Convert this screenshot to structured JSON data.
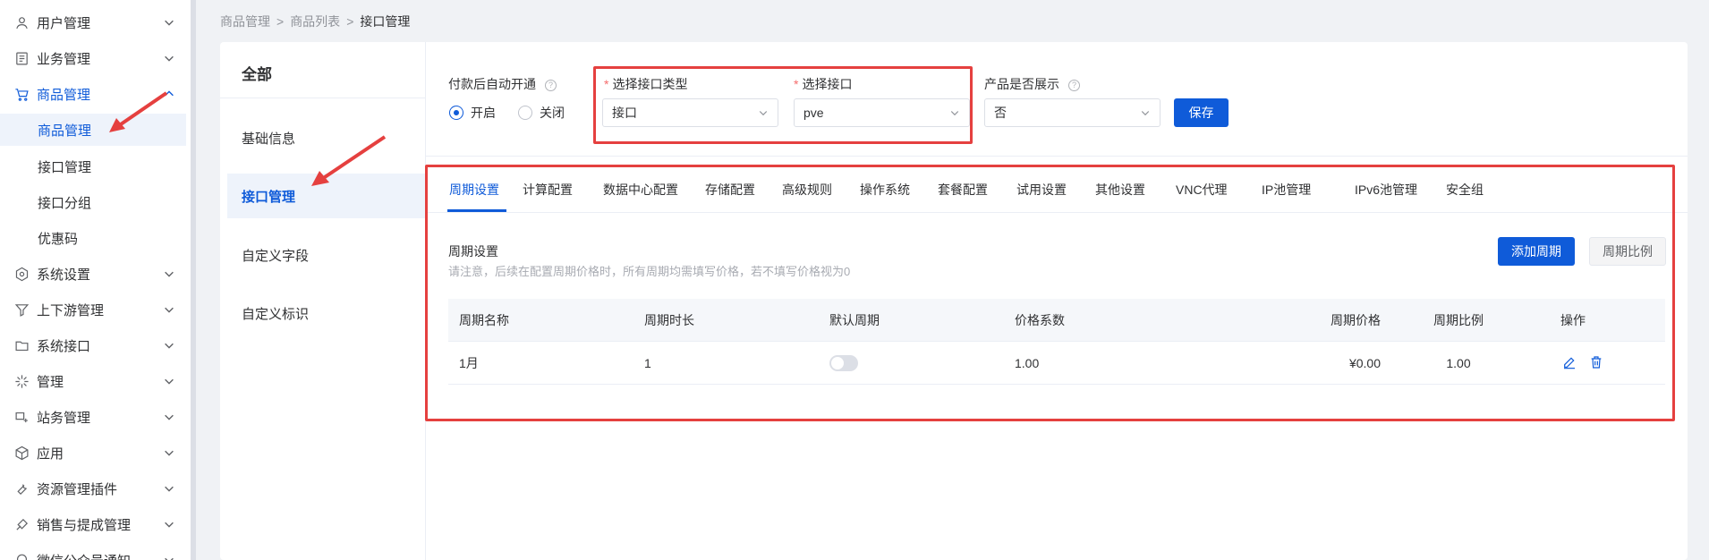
{
  "sidebar": {
    "items": [
      {
        "label": "用户管理",
        "icon": "user-icon"
      },
      {
        "label": "业务管理",
        "icon": "document-icon"
      },
      {
        "label": "商品管理",
        "icon": "cart-icon"
      },
      {
        "label": "系统设置",
        "icon": "gear-icon"
      },
      {
        "label": "上下游管理",
        "icon": "filter-icon"
      },
      {
        "label": "系统接口",
        "icon": "folder-icon"
      },
      {
        "label": "管理",
        "icon": "sparkle-icon"
      },
      {
        "label": "站务管理",
        "icon": "station-icon"
      },
      {
        "label": "应用",
        "icon": "cube-icon"
      },
      {
        "label": "资源管理插件",
        "icon": "wrench-icon"
      },
      {
        "label": "销售与提成管理",
        "icon": "sales-icon"
      },
      {
        "label": "微信公众号通知",
        "icon": "wechat-icon"
      }
    ],
    "product_sub": [
      "商品管理",
      "接口管理",
      "接口分组",
      "优惠码"
    ]
  },
  "breadcrumb": [
    "商品管理",
    "商品列表",
    "接口管理"
  ],
  "breadcrumb_sep": ">",
  "leftnav": {
    "title": "全部",
    "items": [
      "基础信息",
      "接口管理",
      "自定义字段",
      "自定义标识"
    ]
  },
  "form": {
    "auto_open_label": "付款后自动开通",
    "help_glyph": "?",
    "required_mark": "*",
    "radio_on": "开启",
    "radio_off": "关闭",
    "iface_type_label": "选择接口类型",
    "iface_type_value": "接口",
    "iface_label": "选择接口",
    "iface_value": "pve",
    "show_label": "产品是否展示",
    "show_value": "否",
    "save_label": "保存"
  },
  "tabs": [
    "周期设置",
    "计算配置",
    "数据中心配置",
    "存储配置",
    "高级规则",
    "操作系统",
    "套餐配置",
    "试用设置",
    "其他设置",
    "VNC代理",
    "IP池管理",
    "IPv6池管理",
    "安全组"
  ],
  "section": {
    "title": "周期设置",
    "hint": "请注意，后续在配置周期价格时，所有周期均需填写价格，若不填写价格视为0",
    "add_label": "添加周期",
    "ratio_label": "周期比例"
  },
  "table": {
    "headers": [
      "周期名称",
      "周期时长",
      "默认周期",
      "价格系数",
      "周期价格",
      "周期比例",
      "操作"
    ],
    "rows": [
      {
        "name": "1月",
        "duration": "1",
        "coef": "1.00",
        "price": "¥0.00",
        "ratio": "1.00",
        "default_on": false
      }
    ]
  },
  "colors": {
    "accent": "#0f5bd9",
    "annotation": "#e5403f"
  }
}
